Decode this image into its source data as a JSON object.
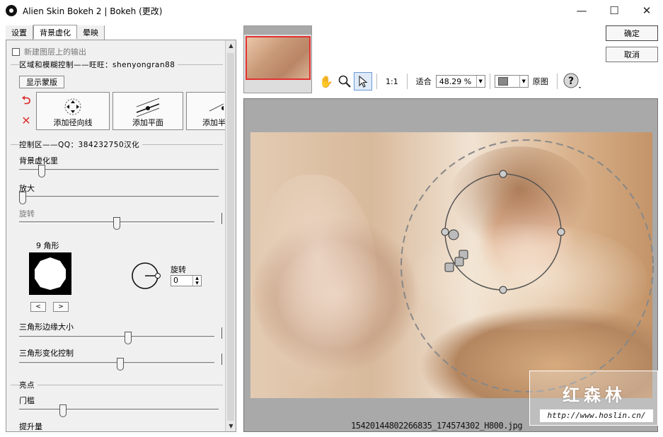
{
  "window": {
    "title": "Alien Skin Bokeh 2 | Bokeh (更改)",
    "minimize": "—",
    "maximize": "☐",
    "close": "✕"
  },
  "tabs": [
    {
      "label": "设置"
    },
    {
      "label": "背景虚化"
    },
    {
      "label": "晕映"
    }
  ],
  "left": {
    "new_layer_label": "新建图层上的输出",
    "region_group": "区域和模糊控制——旺旺：shenyongran88",
    "show_mask": "显示蒙版",
    "add_radial": "添加径向线",
    "add_plane": "添加平面",
    "add_third": "添加半",
    "control_group": "控制区——QQ：384232750汉化",
    "blur_amount": "背景虚化里",
    "size": "放大",
    "rotate": "旋转",
    "polygon_label": "9 角形",
    "prev": "<",
    "next": ">",
    "rotation_label": "旋转",
    "rotation_value": "0",
    "tri_edge": "三角形边缘大小",
    "tri_change": "三角形变化控制",
    "highlight_group": "亮点",
    "threshold": "门槛",
    "boost": "提升量",
    "sliders": {
      "blur_amount": 0.1,
      "size": 0.0,
      "rotate": 0.5,
      "tri_edge": 0.56,
      "tri_change": 0.52,
      "threshold": 0.21
    }
  },
  "toolbar": {
    "one_to_one": "1:1",
    "fit": "适合",
    "zoom": "48.29 %",
    "original": "原图",
    "help": "?"
  },
  "buttons": {
    "ok": "确定",
    "cancel": "取消"
  },
  "canvas": {
    "filename": "15420144802266835_174574302_H800.jpg"
  },
  "watermark": {
    "title": "红森林",
    "url": "http://www.hoslin.cn/"
  },
  "colors": {
    "accent_red": "#e23030",
    "panel_bg": "#f0f0f0",
    "canvas_bg": "#a9a9a9"
  }
}
